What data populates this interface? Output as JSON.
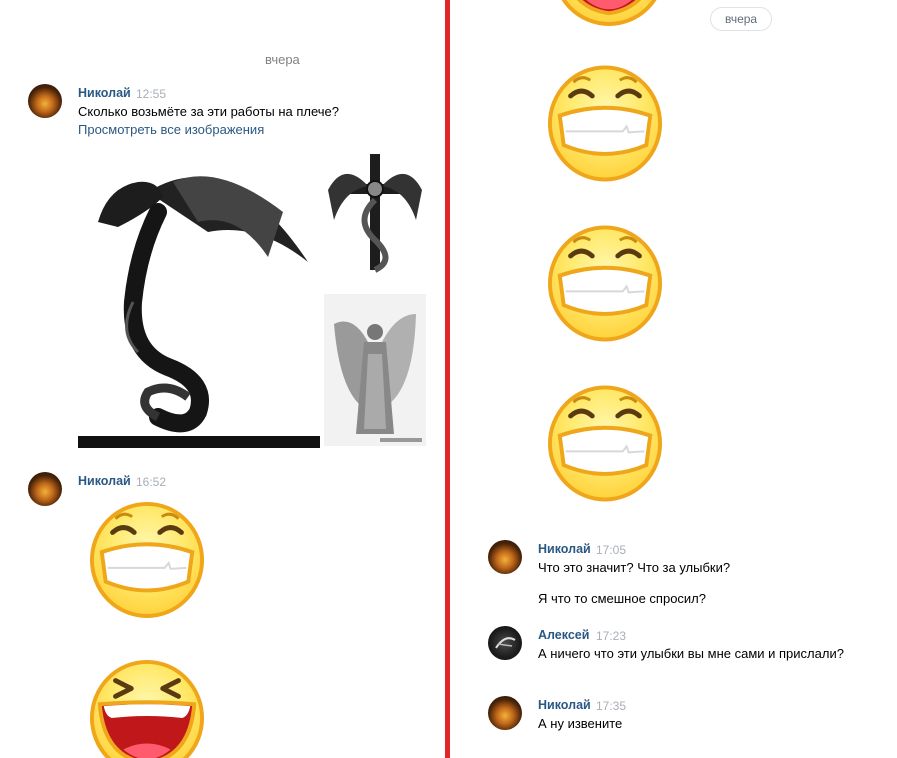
{
  "left": {
    "date_divider": "вчера",
    "messages": [
      {
        "author": "Николай",
        "time": "12:55",
        "text": "Сколько возьмёте за эти работы на плече?",
        "link": "Просмотреть все изображения",
        "attachments": [
          "dragon-tattoo",
          "cross-dragon-tattoo",
          "angel-tattoo"
        ]
      },
      {
        "author": "Николай",
        "time": "16:52",
        "stickers": [
          "grin-smiley",
          "laughing-smiley"
        ]
      }
    ]
  },
  "right": {
    "date_divider": "вчера",
    "stickers_top": [
      "laughing-smiley",
      "grin-smiley",
      "grin-smiley",
      "grin-smiley"
    ],
    "messages": [
      {
        "author": "Николай",
        "time": "17:05",
        "lines": [
          "Что это значит? Что за улыбки?",
          "Я что то смешное спросил?"
        ]
      },
      {
        "author": "Алексей",
        "time": "17:23",
        "text": "А ничего что эти улыбки вы мне сами и прислали?"
      },
      {
        "author": "Николай",
        "time": "17:35",
        "text": "А ну извените"
      }
    ]
  },
  "colors": {
    "divider": "#e0262b",
    "author_name": "#2a5885",
    "link": "#2a5885",
    "timestamp": "#a8afb6",
    "sticker_face": "#ffe96b",
    "sticker_outline": "#f0a61a"
  }
}
